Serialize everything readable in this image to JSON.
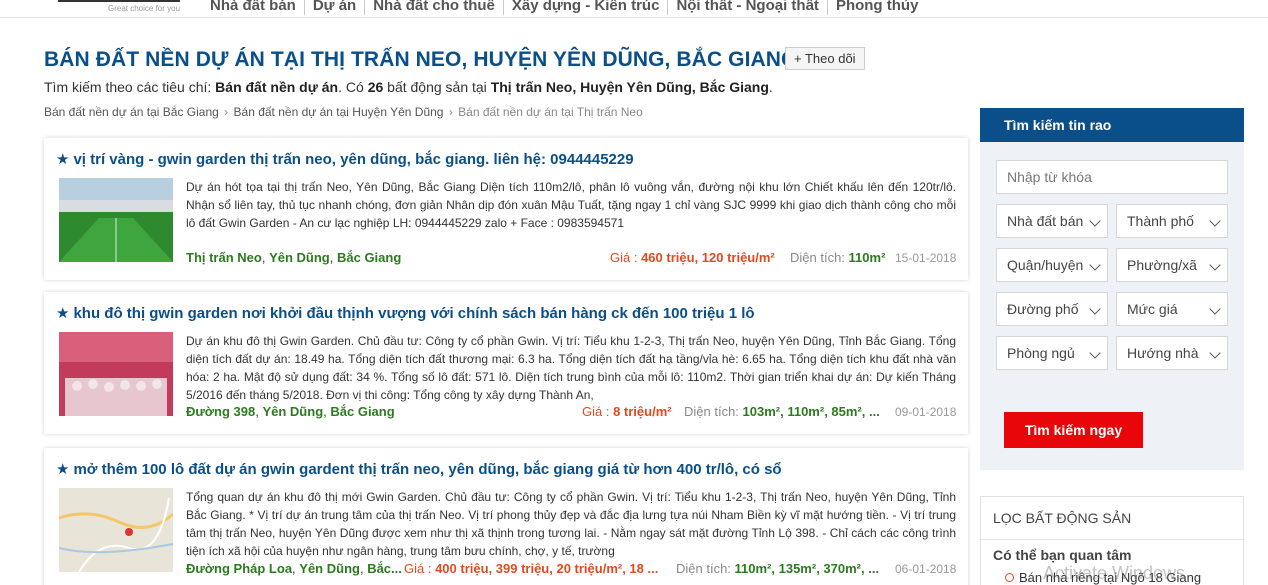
{
  "header": {
    "logo_tagline": "Great choice for you",
    "nav": [
      "Nhà đất bán",
      "Dự án",
      "Nhà đất cho thuê",
      "Xây dựng - Kiến trúc",
      "Nội thất - Ngoại thất",
      "Phong thủy"
    ]
  },
  "page": {
    "title": "BÁN ĐẤT NỀN DỰ ÁN TẠI THỊ TRẤN NEO, HUYỆN YÊN DŨNG, BẮC GIANG",
    "follow_label": "+ Theo dõi",
    "summary_prefix": "Tìm kiếm theo các tiêu chí: ",
    "summary_criteria": "Bán đất nền dự án",
    "summary_mid": ". Có ",
    "summary_count": "26",
    "summary_mid2": " bất động sản tại ",
    "summary_place": "Thị trấn Neo, Huyện Yên Dũng, Bắc Giang",
    "summary_end": ".",
    "breadcrumb": [
      "Bán đất nền dự án tại Bắc Giang",
      "Bán đất nền dự án tại Huyện Yên Dũng",
      "Bán đất nền dự án tại Thị trấn Neo"
    ],
    "breadcrumb_sep": "›"
  },
  "listings": [
    {
      "title": "vị trí vàng - gwin garden thị trấn neo, yên dũng, bắc giang. liên hệ: 0944445229",
      "desc": "Dự án hót tọa tại thị trấn Neo, Yên Dũng, Bắc Giang Diện tích 110m2/lô, phân lô vuông vắn, đường nội khu lớn Chiết khấu lên đến 120tr/lô. Nhận sổ liên tay, thủ tục nhanh chóng, đơn giản Nhân dịp đón xuân Mậu Tuất, tặng ngay 1 chỉ vàng SJC 9999 khi giao dịch thành công cho mỗi lô đất Gwin Garden - An cư lạc nghiệp LH: 0944445229 zalo + Face : 0983594571",
      "loc": [
        "Thị trấn Neo",
        "Yên Dũng",
        "Bắc Giang"
      ],
      "price_label": "Giá : ",
      "price": "460 triệu, 120 triệu/m²",
      "area_label": "Diện tích: ",
      "area": "110m²",
      "date": "15-01-2018"
    },
    {
      "title": "khu đô thị gwin garden nơi khởi đầu thịnh vượng với chính sách bán hàng ck đến 100 triệu 1 lô",
      "desc": "Dự án khu đô thị Gwin Garden. Chủ đầu tư: Công ty cổ phần Gwin. Vị trí: Tiểu khu 1-2-3, Thị trấn Neo, huyện Yên Dũng, Tỉnh Bắc Giang. Tổng diện tích đất dự án: 18.49 ha. Tổng diện tích đất thương mại: 6.3 ha. Tổng diện tích đất hạ tầng/vỉa hè: 6.65 ha. Tổng diện tích khu đất nhà văn hóa: 2 ha. Mật độ sử dụng đất: 34 %. Tổng số lô đất: 571 lô. Diện tích trung bình của mỗi lô: 110m2. Thời gian triển khai dự án: Dự kiến Tháng 5/2016 đến tháng 5/2018. Đơn vị thi công: Tổng công ty xây dựng Thành An,",
      "loc": [
        "Đường 398",
        "Yên Dũng",
        "Bắc Giang"
      ],
      "price_label": "Giá : ",
      "price": "8 triệu/m²",
      "area_label": "Diện tích: ",
      "area": "103m², 110m², 85m², ...",
      "date": "09-01-2018"
    },
    {
      "title": "mở thêm 100 lô đất dự án gwin gardent thị trấn neo, yên dũng, bắc giang giá từ hơn 400 tr/lô, có sổ",
      "desc": "Tổng quan dự án khu đô thị mới Gwin Garden. Chủ đầu tư: Công ty cổ phần Gwin. Vị trí: Tiểu khu 1-2-3, Thị trấn Neo, huyện Yên Dũng, Tỉnh Bắc Giang. * Vị trí dự án trung tâm của thị trấn Neo. Vị trí phong thủy đẹp và đắc địa lưng tựa núi Nham Biền kỳ vĩ mặt hướng tiền. - Vị trí trung tâm thị trấn Neo, huyện Yên Dũng được xem như thị xã thịnh trong tương lai. - Nằm ngay sát mặt đường Tỉnh Lộ 398. - Chỉ cách các công trình tiện ích xã hội của huyện như ngân hàng, trung tâm bưu chính, chợ, y tế, trường",
      "loc": [
        "Đường Pháp Loa",
        "Yên Dũng",
        "Bắc..."
      ],
      "price_label": "Giá : ",
      "price": "400 triệu, 399 triệu, 20 triệu/m², 18 ...",
      "area_label": "Diện tích: ",
      "area": "110m², 135m², 370m², ...",
      "date": "06-01-2018"
    }
  ],
  "sidebar": {
    "search_title": "Tìm kiếm tin rao",
    "keyword_placeholder": "Nhập từ khóa",
    "selects": [
      "Nhà đất bán",
      "Thành phố",
      "Quận/huyện",
      "Phường/xã",
      "Đường phố",
      "Mức giá",
      "Phòng ngủ",
      "Hướng nhà"
    ],
    "search_button": "Tìm kiếm ngay",
    "filter_title": "LỌC BẤT ĐỘNG SẢN",
    "filter_subtitle": "Có thể bạn quan tâm",
    "filter_item": "Bán nhà riêng tại Ngõ 18 Giang"
  },
  "watermark": "Activate Windows",
  "colors": {
    "brand": "#0b4f8a",
    "accent": "#e8060b",
    "location": "#2c7a1f",
    "price": "#e04a1f"
  }
}
